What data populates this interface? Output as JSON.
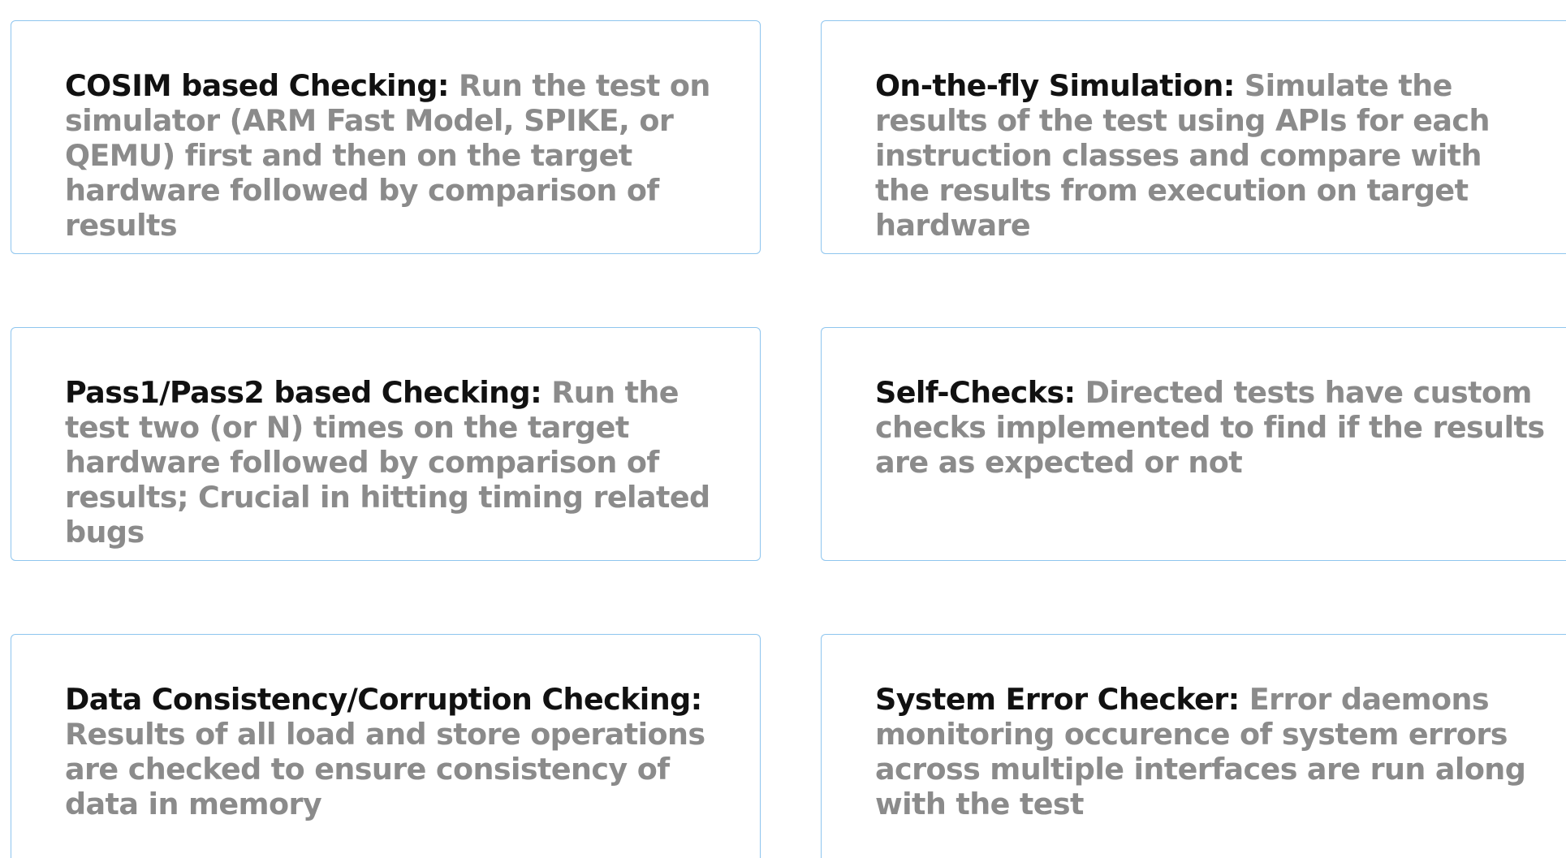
{
  "cards": [
    {
      "title": "COSIM based Checking:",
      "description": "Run the test on simulator (ARM Fast Model, SPIKE, or QEMU) first and then on the target hardware followed by comparison of results"
    },
    {
      "title": "On-the-fly Simulation:",
      "description": "Simulate the results of the test using APIs for each instruction classes and compare with the results from execution on target hardware"
    },
    {
      "title": "Pass1/Pass2 based Checking:",
      "description": "Run the test two (or N) times on the target hardware followed by  comparison of results; Crucial in hitting timing related bugs"
    },
    {
      "title": "Self-Checks:",
      "description": "Directed tests have custom checks implemented to find if the results are as expected or not"
    },
    {
      "title": "Data Consistency/Corruption Checking:",
      "description": "Results of all load and store operations are checked to ensure consistency of data in memory"
    },
    {
      "title": "System Error Checker:",
      "description": "Error daemons monitoring occurence of system errors across multiple interfaces are run along with the test"
    }
  ],
  "colors": {
    "border": "#8ec5ee",
    "title": "#111111",
    "description": "#8b8b8b",
    "background": "#ffffff"
  }
}
